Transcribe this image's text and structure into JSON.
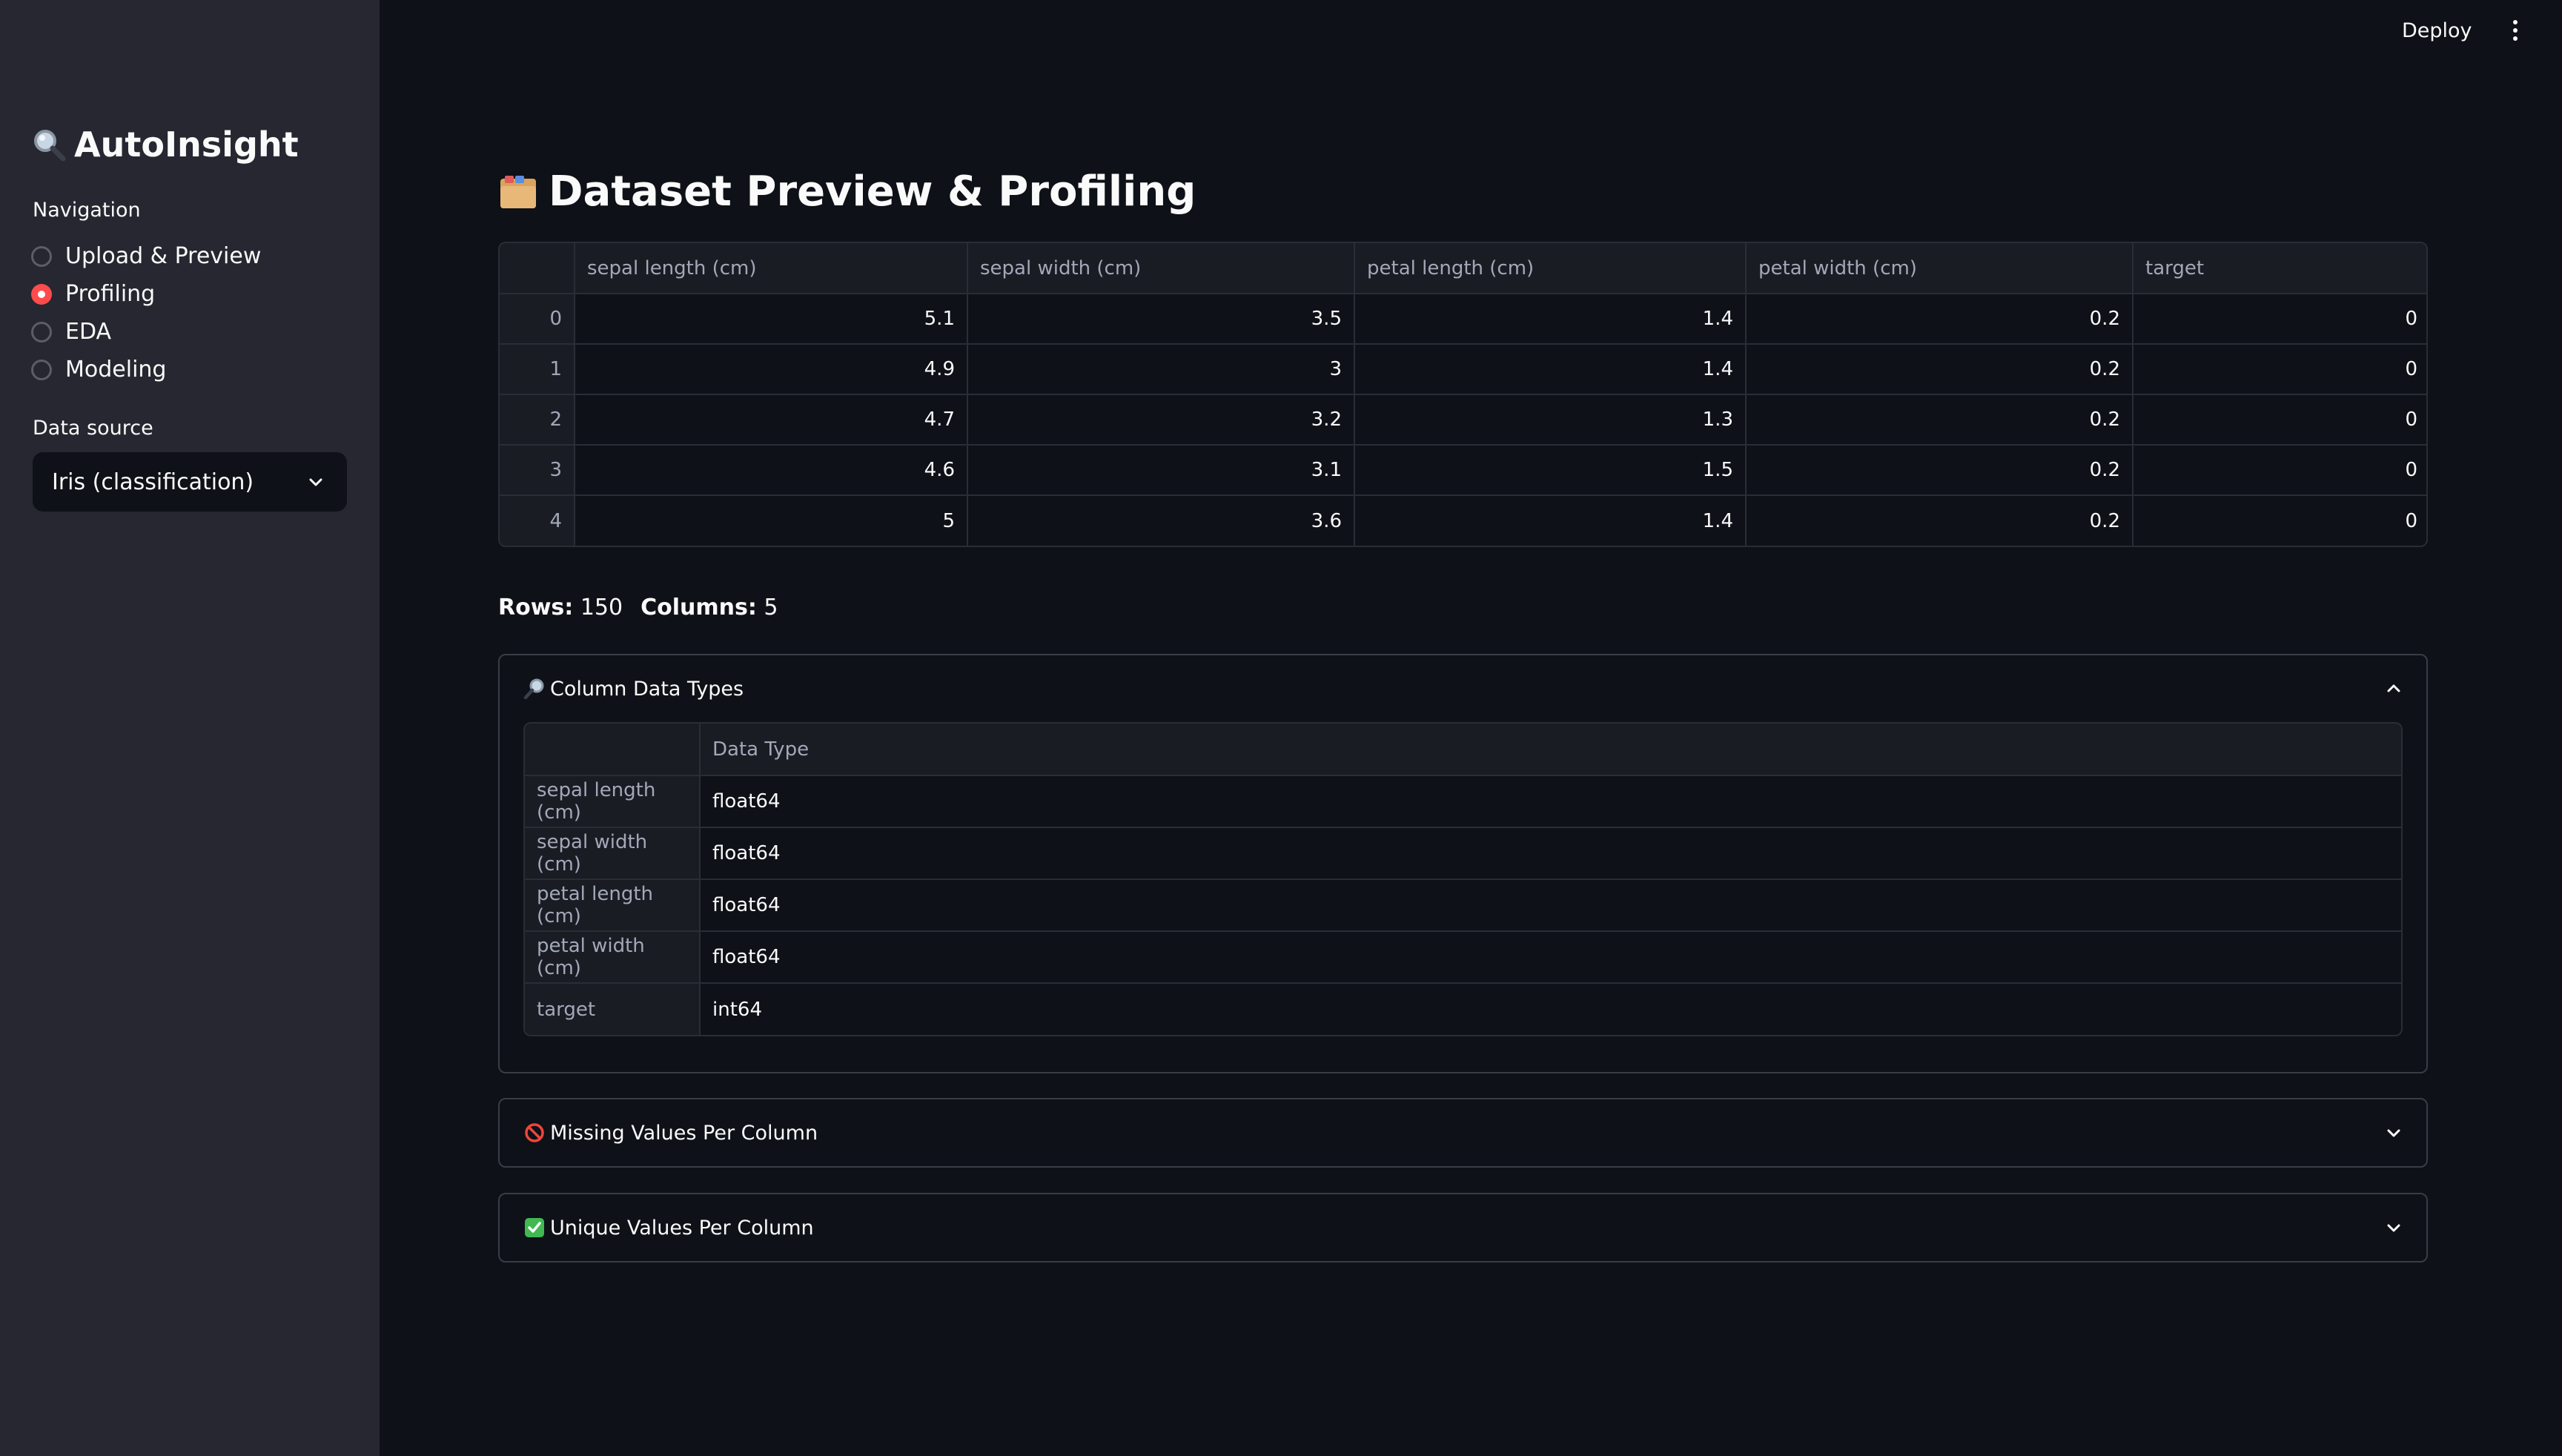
{
  "app": {
    "title": "AutoInsight",
    "deploy_label": "Deploy"
  },
  "sidebar": {
    "nav_label": "Navigation",
    "nav_items": [
      {
        "label": "Upload & Preview",
        "selected": false
      },
      {
        "label": "Profiling",
        "selected": true
      },
      {
        "label": "EDA",
        "selected": false
      },
      {
        "label": "Modeling",
        "selected": false
      }
    ],
    "data_source_label": "Data source",
    "data_source_value": "Iris (classification)"
  },
  "main": {
    "title": "Dataset Preview & Profiling",
    "preview_table": {
      "columns": [
        "sepal length (cm)",
        "sepal width (cm)",
        "petal length (cm)",
        "petal width (cm)",
        "target"
      ],
      "rows": [
        {
          "index": "0",
          "cells": [
            "5.1",
            "3.5",
            "1.4",
            "0.2",
            "0"
          ]
        },
        {
          "index": "1",
          "cells": [
            "4.9",
            "3",
            "1.4",
            "0.2",
            "0"
          ]
        },
        {
          "index": "2",
          "cells": [
            "4.7",
            "3.2",
            "1.3",
            "0.2",
            "0"
          ]
        },
        {
          "index": "3",
          "cells": [
            "4.6",
            "3.1",
            "1.5",
            "0.2",
            "0"
          ]
        },
        {
          "index": "4",
          "cells": [
            "5",
            "3.6",
            "1.4",
            "0.2",
            "0"
          ]
        }
      ]
    },
    "stats": {
      "rows_label": "Rows:",
      "rows_value": "150",
      "columns_label": "Columns:",
      "columns_value": "5"
    },
    "expanders": {
      "dtypes": {
        "title": "Column Data Types",
        "expanded": true,
        "header": "Data Type",
        "rows": [
          {
            "name": "sepal length (cm)",
            "type": "float64"
          },
          {
            "name": "sepal width (cm)",
            "type": "float64"
          },
          {
            "name": "petal length (cm)",
            "type": "float64"
          },
          {
            "name": "petal width (cm)",
            "type": "float64"
          },
          {
            "name": "target",
            "type": "int64"
          }
        ]
      },
      "missing": {
        "title": "Missing Values Per Column",
        "expanded": false
      },
      "unique": {
        "title": "Unique Values Per Column",
        "expanded": false
      }
    }
  },
  "colors": {
    "background": "#0e1117",
    "sidebar": "#262730",
    "accent": "#ff4b4b",
    "text": "#fafafa",
    "muted_text": "#a3a8b8"
  },
  "icons": {
    "app_logo": "magnifying-glass-icon",
    "page_title": "card-index-dividers-icon",
    "dtypes": "magnifying-glass-tilted-right-icon",
    "missing": "prohibited-icon",
    "unique": "check-mark-button-icon",
    "select": "chevron-down-icon",
    "menu": "kebab-menu-icon"
  }
}
